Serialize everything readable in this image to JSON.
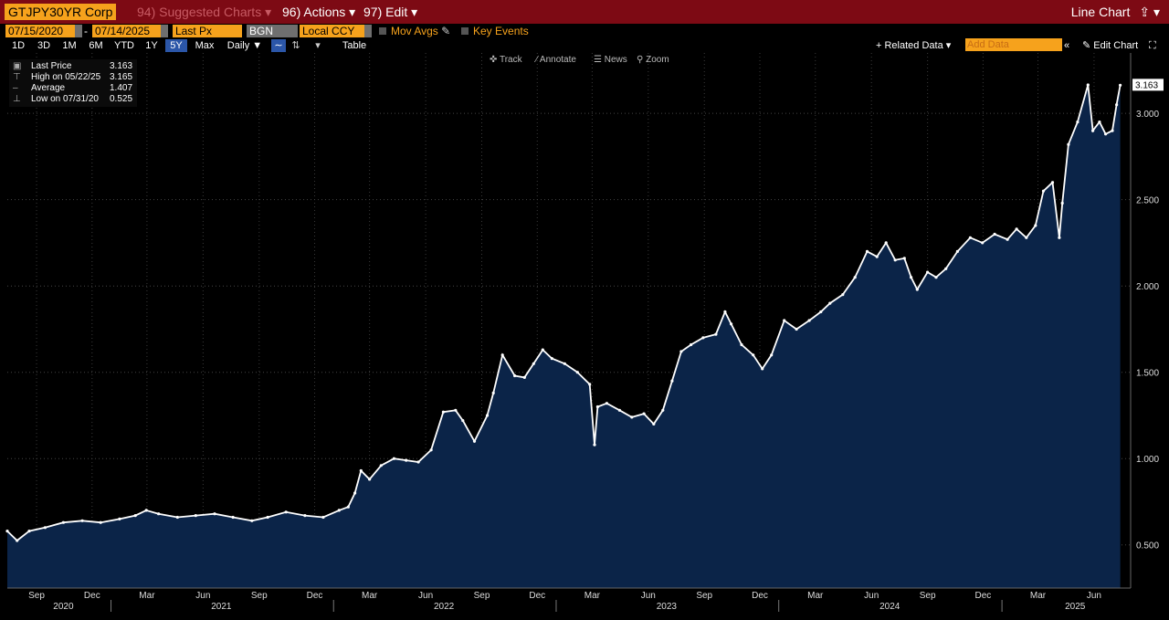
{
  "header": {
    "ticker": "GTJPY30YR Corp",
    "suggested": "94) Suggested Charts",
    "actions": "96) Actions",
    "edit": "97) Edit",
    "chart_type": "Line Chart"
  },
  "toolbar": {
    "start_date": "07/15/2020",
    "end_date": "07/14/2025",
    "field": "Last Px",
    "source": "BGN",
    "currency": "Local CCY",
    "mov_avgs": "Mov Avgs",
    "key_events": "Key Events",
    "ranges": [
      "1D",
      "3D",
      "1M",
      "6M",
      "YTD",
      "1Y",
      "5Y",
      "Max"
    ],
    "active_range": "5Y",
    "frequency": "Daily",
    "table": "Table",
    "related_data": "Related Data",
    "add_data_placeholder": "Add Data",
    "edit_chart": "Edit Chart",
    "tools": [
      "Track",
      "Annotate",
      "News",
      "Zoom"
    ]
  },
  "legend": {
    "last_label": "Last Price",
    "last_value": "3.163",
    "high_label": "High on 05/22/25",
    "high_value": "3.165",
    "avg_label": "Average",
    "avg_value": "1.407",
    "low_label": "Low on 07/31/20",
    "low_value": "0.525"
  },
  "colors": {
    "line": "#ffffff",
    "area": "#0b2448",
    "accent": "#f6a21c",
    "topbar": "#7d0a14"
  },
  "chart_data": {
    "type": "area",
    "title": "",
    "xlabel": "",
    "ylabel": "",
    "ylim": [
      0.25,
      3.35
    ],
    "y_ticks": [
      0.5,
      1.0,
      1.5,
      2.0,
      2.5,
      3.0
    ],
    "y_tick_labels": [
      "0.500",
      "1.000",
      "1.500",
      "2.000",
      "2.500",
      "3.000"
    ],
    "last_value_label": "3.163",
    "x_month_labels": [
      {
        "date": "2020-09-01",
        "label": "Sep"
      },
      {
        "date": "2020-12-01",
        "label": "Dec"
      },
      {
        "date": "2021-03-01",
        "label": "Mar"
      },
      {
        "date": "2021-06-01",
        "label": "Jun"
      },
      {
        "date": "2021-09-01",
        "label": "Sep"
      },
      {
        "date": "2021-12-01",
        "label": "Dec"
      },
      {
        "date": "2022-03-01",
        "label": "Mar"
      },
      {
        "date": "2022-06-01",
        "label": "Jun"
      },
      {
        "date": "2022-09-01",
        "label": "Sep"
      },
      {
        "date": "2022-12-01",
        "label": "Dec"
      },
      {
        "date": "2023-03-01",
        "label": "Mar"
      },
      {
        "date": "2023-06-01",
        "label": "Jun"
      },
      {
        "date": "2023-09-01",
        "label": "Sep"
      },
      {
        "date": "2023-12-01",
        "label": "Dec"
      },
      {
        "date": "2024-03-01",
        "label": "Mar"
      },
      {
        "date": "2024-06-01",
        "label": "Jun"
      },
      {
        "date": "2024-09-01",
        "label": "Sep"
      },
      {
        "date": "2024-12-01",
        "label": "Dec"
      },
      {
        "date": "2025-03-01",
        "label": "Mar"
      },
      {
        "date": "2025-06-01",
        "label": "Jun"
      }
    ],
    "x_year_labels": [
      {
        "date": "2020-10-15",
        "label": "2020"
      },
      {
        "date": "2021-07-01",
        "label": "2021"
      },
      {
        "date": "2022-07-01",
        "label": "2022"
      },
      {
        "date": "2023-07-01",
        "label": "2023"
      },
      {
        "date": "2024-07-01",
        "label": "2024"
      },
      {
        "date": "2025-05-01",
        "label": "2025"
      }
    ],
    "series": [
      {
        "x": [
          "2020-07-15",
          "2020-07-31",
          "2020-08-20",
          "2020-09-15",
          "2020-10-15",
          "2020-11-15",
          "2020-12-15",
          "2021-01-15",
          "2021-02-10",
          "2021-02-28",
          "2021-03-20",
          "2021-04-20",
          "2021-05-20",
          "2021-06-20",
          "2021-07-20",
          "2021-08-20",
          "2021-09-15",
          "2021-10-15",
          "2021-11-15",
          "2021-12-15",
          "2022-01-10",
          "2022-01-25",
          "2022-02-05",
          "2022-02-15",
          "2022-03-01",
          "2022-03-20",
          "2022-04-10",
          "2022-04-30",
          "2022-05-20",
          "2022-06-10",
          "2022-06-30",
          "2022-07-20",
          "2022-08-01",
          "2022-08-20",
          "2022-09-10",
          "2022-09-20",
          "2022-10-05",
          "2022-10-25",
          "2022-11-10",
          "2022-11-25",
          "2022-12-10",
          "2022-12-25",
          "2023-01-15",
          "2023-02-05",
          "2023-02-25",
          "2023-03-05",
          "2023-03-10",
          "2023-03-25",
          "2023-04-15",
          "2023-05-05",
          "2023-05-25",
          "2023-06-10",
          "2023-06-25",
          "2023-07-10",
          "2023-07-25",
          "2023-08-10",
          "2023-08-30",
          "2023-09-20",
          "2023-10-05",
          "2023-10-15",
          "2023-11-01",
          "2023-11-20",
          "2023-12-05",
          "2023-12-20",
          "2024-01-10",
          "2024-01-30",
          "2024-02-20",
          "2024-03-10",
          "2024-03-25",
          "2024-04-15",
          "2024-05-05",
          "2024-05-25",
          "2024-06-10",
          "2024-06-25",
          "2024-07-10",
          "2024-07-25",
          "2024-08-05",
          "2024-08-15",
          "2024-09-01",
          "2024-09-15",
          "2024-10-01",
          "2024-10-20",
          "2024-11-10",
          "2024-11-30",
          "2024-12-20",
          "2025-01-10",
          "2025-01-25",
          "2025-02-10",
          "2025-02-25",
          "2025-03-10",
          "2025-03-25",
          "2025-04-05",
          "2025-04-10",
          "2025-04-20",
          "2025-05-05",
          "2025-05-22",
          "2025-05-30",
          "2025-06-10",
          "2025-06-20",
          "2025-07-01",
          "2025-07-08",
          "2025-07-14"
        ],
        "values": [
          0.58,
          0.525,
          0.58,
          0.6,
          0.63,
          0.64,
          0.63,
          0.65,
          0.67,
          0.7,
          0.68,
          0.66,
          0.67,
          0.68,
          0.66,
          0.64,
          0.66,
          0.69,
          0.67,
          0.66,
          0.7,
          0.72,
          0.8,
          0.93,
          0.88,
          0.96,
          1.0,
          0.99,
          0.98,
          1.05,
          1.27,
          1.28,
          1.22,
          1.1,
          1.25,
          1.38,
          1.6,
          1.48,
          1.47,
          1.55,
          1.63,
          1.58,
          1.55,
          1.5,
          1.43,
          1.08,
          1.3,
          1.32,
          1.28,
          1.24,
          1.26,
          1.2,
          1.28,
          1.45,
          1.62,
          1.66,
          1.7,
          1.72,
          1.85,
          1.78,
          1.66,
          1.6,
          1.52,
          1.6,
          1.8,
          1.75,
          1.8,
          1.85,
          1.9,
          1.95,
          2.05,
          2.2,
          2.17,
          2.25,
          2.15,
          2.16,
          2.05,
          1.98,
          2.08,
          2.05,
          2.1,
          2.2,
          2.28,
          2.25,
          2.3,
          2.27,
          2.33,
          2.28,
          2.35,
          2.55,
          2.6,
          2.28,
          2.48,
          2.82,
          2.95,
          3.165,
          2.9,
          2.95,
          2.88,
          2.9,
          3.05,
          3.163
        ]
      }
    ]
  }
}
